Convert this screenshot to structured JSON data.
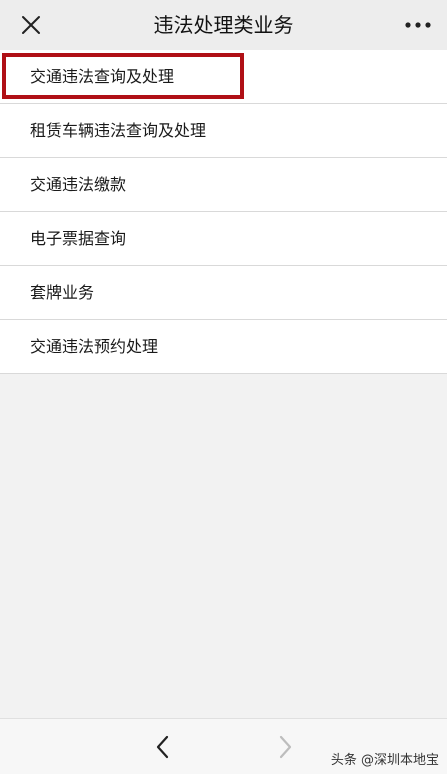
{
  "header": {
    "title": "违法处理类业务",
    "close_icon": "close-icon",
    "more_icon": "more-dots-icon"
  },
  "menu": {
    "items": [
      {
        "label": "交通违法查询及处理",
        "highlighted": true
      },
      {
        "label": "租赁车辆违法查询及处理"
      },
      {
        "label": "交通违法缴款"
      },
      {
        "label": "电子票据查询"
      },
      {
        "label": "套牌业务"
      },
      {
        "label": "交通违法预约处理"
      }
    ]
  },
  "highlight_color": "#b01016",
  "bottom_nav": {
    "back_icon": "chevron-left-icon",
    "forward_icon": "chevron-right-icon",
    "watermark": "头条 @深圳本地宝"
  }
}
